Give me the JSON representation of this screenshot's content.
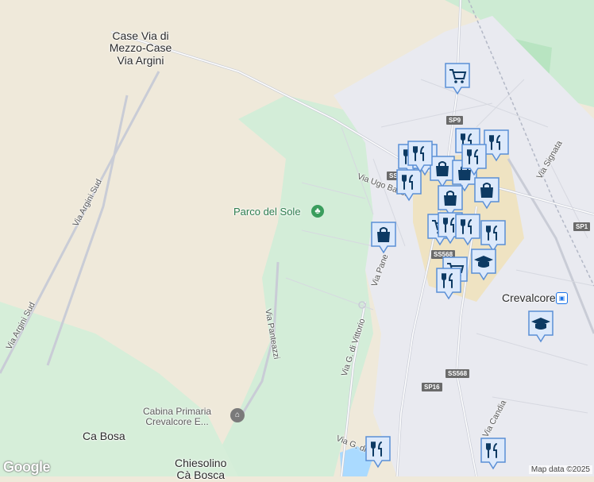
{
  "map": {
    "labels": {
      "case_via": "Case Via di\nMezzo-Case\nVia Argini",
      "parco": "Parco del Sole",
      "via_ugo_bassi": "Via Ugo Bassi",
      "via_argini_sud_1": "Via Argini Sud",
      "via_argini_sud_2": "Via Argini Sud",
      "via_panteazzi": "Via Panteazzi",
      "via_pane": "Via Pane",
      "via_vittorio": "Via G. di Vittorio",
      "via_signata": "Via Signata",
      "via_candia": "Via Candia",
      "via_gdi": "Via G. di",
      "crevalcore": "Crevalcore",
      "cabina": "Cabina Primaria\nCrevalcore E...",
      "chiesolino": "Chiesolino\nCà Bosca",
      "casa": "Ca Bosa"
    },
    "shields": {
      "sp9": "SP9",
      "sp1": "SP1",
      "ss568_a": "SS568",
      "ss568_b": "SS568",
      "sp16": "SP16",
      "ss5_partial": "SS"
    },
    "markers": [
      {
        "icon": "cart",
        "name": "cart-marker-top"
      },
      {
        "icon": "cutlery",
        "name": "restaurant-marker-1"
      },
      {
        "icon": "cutlery",
        "name": "restaurant-marker-2"
      },
      {
        "icon": "cutlery",
        "name": "restaurant-marker-3"
      },
      {
        "icon": "cutlery",
        "name": "restaurant-marker-4"
      },
      {
        "icon": "cutlery",
        "name": "restaurant-marker-5"
      },
      {
        "icon": "bag",
        "name": "shop-marker-1"
      },
      {
        "icon": "bag",
        "name": "shop-marker-2"
      },
      {
        "icon": "bag",
        "name": "shop-marker-3"
      },
      {
        "icon": "bag",
        "name": "shop-marker-4"
      },
      {
        "icon": "cutlery",
        "name": "restaurant-marker-6"
      },
      {
        "icon": "cart",
        "name": "cart-marker-2"
      },
      {
        "icon": "cutlery",
        "name": "restaurant-marker-7"
      },
      {
        "icon": "cutlery",
        "name": "restaurant-marker-8"
      },
      {
        "icon": "bag",
        "name": "shop-marker-5"
      },
      {
        "icon": "cart",
        "name": "cart-marker-3"
      },
      {
        "icon": "school",
        "name": "school-marker-1"
      },
      {
        "icon": "cutlery",
        "name": "restaurant-marker-9"
      },
      {
        "icon": "school",
        "name": "school-marker-2"
      },
      {
        "icon": "cutlery",
        "name": "restaurant-marker-10"
      },
      {
        "icon": "cutlery",
        "name": "restaurant-marker-11"
      },
      {
        "icon": "cutlery",
        "name": "restaurant-marker-12"
      },
      {
        "icon": "cutlery",
        "name": "restaurant-marker-13"
      }
    ],
    "attribution": "Map data ©2025",
    "logo": "Google"
  }
}
